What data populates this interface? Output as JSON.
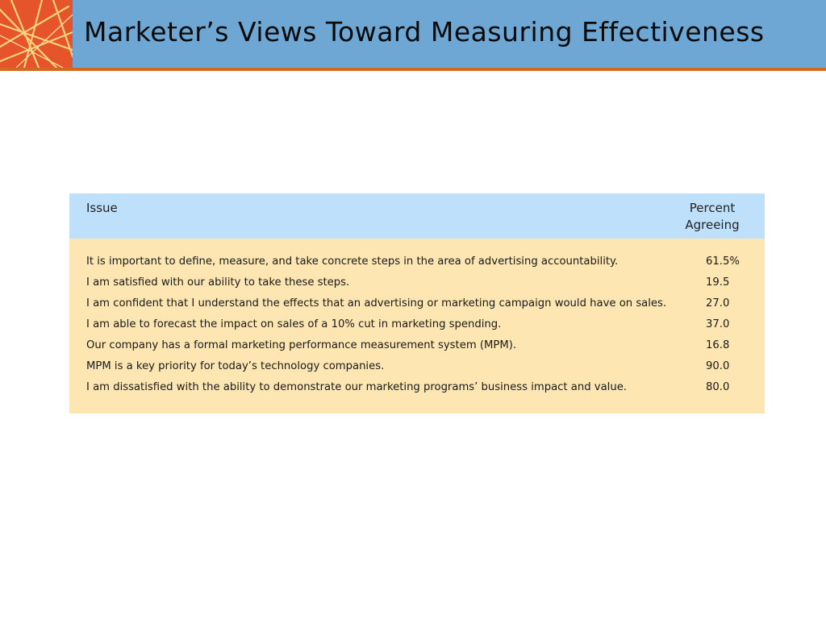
{
  "slide": {
    "title": "Marketer’s Views Toward Measuring Effectiveness"
  },
  "table": {
    "header": {
      "issue": "Issue",
      "percent_line1": "Percent",
      "percent_line2": "Agreeing"
    },
    "rows": [
      {
        "issue": "It is important to define, measure, and take concrete steps in the area of advertising accountability.",
        "percent": "61.5%"
      },
      {
        "issue": "I am satisfied with our ability to take these steps.",
        "percent": "19.5"
      },
      {
        "issue": "I am confident that I understand the effects that an advertising or marketing campaign would have on sales.",
        "percent": "27.0"
      },
      {
        "issue": "I am able to forecast the impact on sales of a 10% cut in marketing spending.",
        "percent": "37.0"
      },
      {
        "issue": "Our company has a formal marketing performance measurement system (MPM).",
        "percent": "16.8"
      },
      {
        "issue": "MPM is a key priority for today’s technology companies.",
        "percent": "90.0"
      },
      {
        "issue": "I am dissatisfied with the ability to demonstrate our marketing programs’ business impact and value.",
        "percent": "80.0"
      }
    ]
  },
  "colors": {
    "header_bar": "#6ea7d4",
    "header_rule": "#d2691e",
    "logo_bg": "#e5542b",
    "table_head_bg": "#bfe0fb",
    "table_body_bg": "#fde6b2"
  },
  "icons": {
    "logo": "abstract-lines-logo"
  }
}
